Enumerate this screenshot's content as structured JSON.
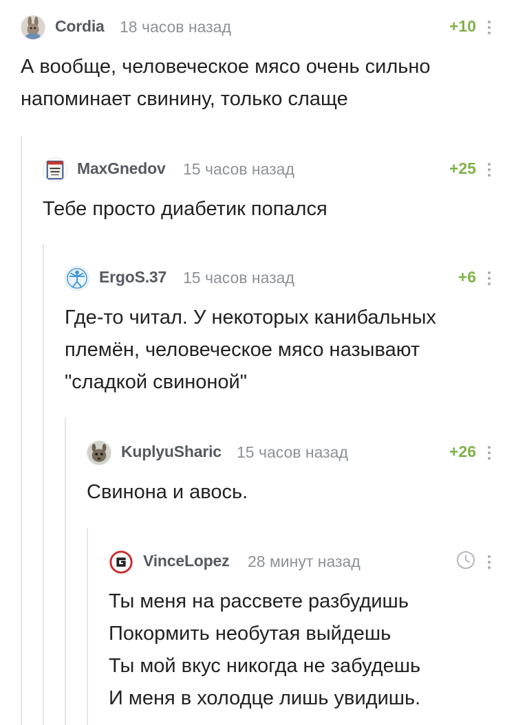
{
  "comments": [
    {
      "username": "Cordia",
      "time": "18 часов назад",
      "rating": "+10",
      "avatar_icon": "bunny-avatar-icon",
      "lines": [
        "А вообще, человеческое мясо очень сильно",
        "напоминает свинину, только слаще"
      ]
    },
    {
      "username": "MaxGnedov",
      "time": "15 часов назад",
      "rating": "+25",
      "avatar_icon": "book-cover-avatar-icon",
      "lines": [
        "Тебе просто диабетик попался"
      ]
    },
    {
      "username": "ErgoS.37",
      "time": "15 часов назад",
      "rating": "+6",
      "avatar_icon": "vitruvian-man-avatar-icon",
      "lines": [
        "Где-то читал. У некоторых канибальных",
        "племён, человеческое мясо называют",
        "\"сладкой свиноной\""
      ]
    },
    {
      "username": "KuplyuSharic",
      "time": "15 часов назад",
      "rating": "+26",
      "avatar_icon": "animal-avatar-icon",
      "lines": [
        "Свинона и авось."
      ]
    },
    {
      "username": "VinceLopez",
      "time": "28 минут назад",
      "rating_icon": "clock-icon",
      "avatar_icon": "g-logo-avatar-icon",
      "lines": [
        "Ты меня на рассвете разбудишь",
        "Покормить необутая выйдешь",
        "Ты мой вкус никогда не забудешь",
        "И меня в холодце лишь увидишь."
      ]
    }
  ],
  "colors": {
    "rating_green": "#7fb248",
    "username": "#555a62",
    "meta_gray": "#8d9196",
    "thread_line": "#e6e6e6",
    "g_logo_red": "#c8282a"
  }
}
